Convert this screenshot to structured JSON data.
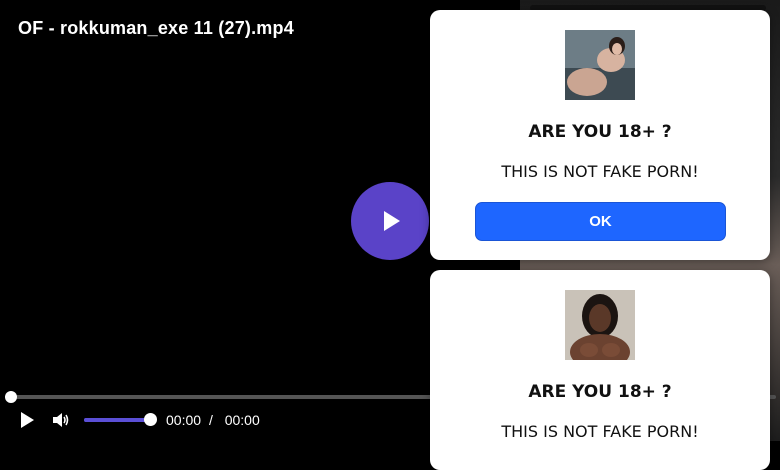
{
  "player": {
    "title": "OF - rokkuman_exe 11 (27).mp4",
    "current_time": "00:00",
    "time_separator": "/",
    "duration": "00:00",
    "progress_fraction": 0.0,
    "volume_fraction": 1.0,
    "accent_color": "#5a43c8"
  },
  "popups": [
    {
      "heading": "ARE YOU 18+ ?",
      "message": "THIS IS NOT FAKE PORN!",
      "button_label": "OK",
      "avatar_icon": "profile-photo"
    },
    {
      "heading": "ARE YOU 18+ ?",
      "message": "THIS IS NOT FAKE PORN!",
      "avatar_icon": "profile-photo"
    }
  ],
  "colors": {
    "ok_button": "#1e66ff",
    "popup_background": "#ffffff",
    "player_background": "#000000"
  }
}
